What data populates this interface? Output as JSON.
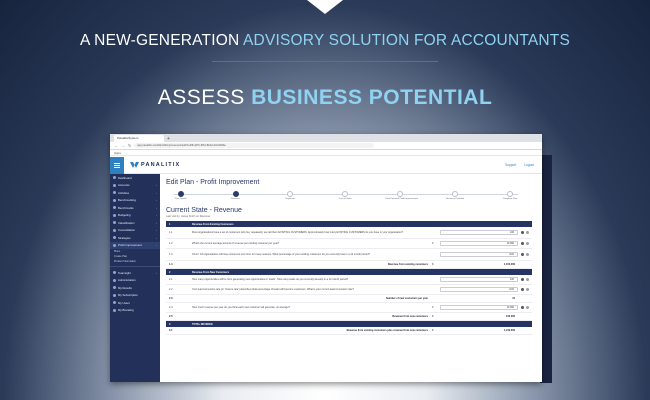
{
  "tagline": {
    "part1": "A NEW-GENERATION ",
    "part2": "ADVISORY SOLUTION FOR ACCOUNTANTS"
  },
  "headline": {
    "part1": "ASSESS ",
    "part2": "BUSINESS POTENTIAL"
  },
  "browser": {
    "tab_title": "PanalitixSystem",
    "new_tab": "+",
    "url": "app.panalitix.com/#/profitimprovement/edit/7e2f8-4d7b-9f61-8b4d-2c1293f4a",
    "bookmarks": "Apps"
  },
  "app": {
    "logo_text": "PANALITIX",
    "header_links": [
      "Support",
      "Logout"
    ],
    "sidebar": {
      "items": [
        {
          "label": "Dashboard"
        },
        {
          "label": "Accounts"
        },
        {
          "label": "Activities"
        },
        {
          "label": "Benchmarking"
        },
        {
          "label": "Benchmarks"
        },
        {
          "label": "Budgeting"
        },
        {
          "label": "Classification"
        },
        {
          "label": "Consolidation"
        },
        {
          "label": "Strategies"
        },
        {
          "label": "Profit Improvement"
        }
      ],
      "subitems": [
        "Plans",
        "Create Plan",
        "Product Information"
      ],
      "lower_items": [
        {
          "label": "Teamsight"
        },
        {
          "label": "Administration"
        },
        {
          "label": "My Results"
        },
        {
          "label": "My Subscription"
        },
        {
          "label": "My Users"
        },
        {
          "label": "My Branding"
        }
      ]
    },
    "page_title": "Edit Plan - Profit Improvement",
    "steps": [
      "Plan Details",
      "Revenue",
      "Expenses",
      "Cost of Sales",
      "Total Potential Profit Improvement",
      "Business Potential",
      "Complete Plan"
    ],
    "section_title": "Current State - Revenue",
    "section_sub": "Last visit by: Janea Smith on Revenue",
    "table": {
      "band1": {
        "num": "1",
        "title": "Revenue From Existing Customers"
      },
      "band2": {
        "num": "2",
        "title": "Revenue From New Customers"
      },
      "band3": {
        "num": "3",
        "title": "TOTAL REVENUE"
      },
      "rows1": [
        {
          "num": "1.1",
          "text": "Most organisations have a set of customers who buy repeatedly, we call them EXISTING CUSTOMERS. Approximately how many EXISTING CUSTOMERS do you have in your organisation?",
          "cur": "",
          "value": "100"
        },
        {
          "num": "1.2",
          "text": "What's the current average amount of revenue per existing customer per year?",
          "cur": "$",
          "value": "10,000"
        },
        {
          "num": "1.3",
          "text": "Churn: All organisations will lose customers over time for many reasons. What percentage of your existing customers do you currently lose in a 12 month period?",
          "cur": "",
          "value": "10%"
        }
      ],
      "total1": {
        "num": "1.4",
        "label": "Revenue from existing customers",
        "cur": "$",
        "value": "1,100,000"
      },
      "rows2": [
        {
          "num": "2.1",
          "text": "How many opportunities will be from generating new opportunities or 'leads'. How many leads do you currently develop in a 12 month period?",
          "cur": "",
          "value": "100"
        },
        {
          "num": "2.2",
          "text": "Your lead conversion rate (or 'closure rate') describes what percentage of leads will become customers. What is your current lead conversion rate?",
          "cur": "",
          "value": "10%"
        },
        {
          "num": "2.3",
          "text": "",
          "label": "Number of new customers per year",
          "value": "10"
        },
        {
          "num": "2.4",
          "text": "How much revenue per year do you think each new customer will generate, on average?",
          "cur": "$",
          "value": "10,000"
        }
      ],
      "total2": {
        "num": "2.5",
        "label": "Revenue from new customers",
        "cur": "$",
        "value": "100,000"
      },
      "total3": {
        "num": "3.1",
        "label": "Revenue from existing customers plus revenue from new customers",
        "cur": "$",
        "value": "1,210,000"
      }
    }
  }
}
